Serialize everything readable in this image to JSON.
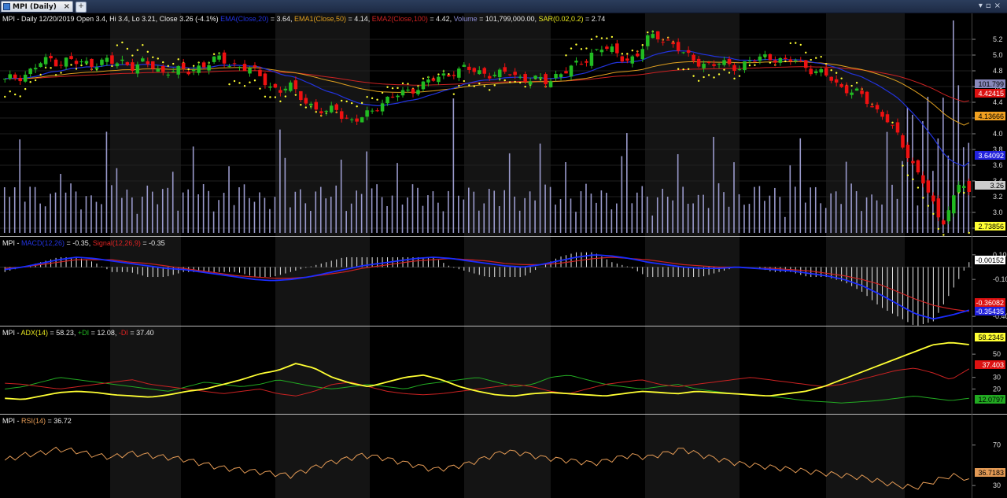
{
  "tab": {
    "title": "MPI (Daily)"
  },
  "header": {
    "sym": "MPI",
    "daily": " - Daily 12/20/2019 Open 3.4, Hi 3.4, Lo 3.21, Close 3.26 (-4.1%) ",
    "ema": "EMA(Close,20)",
    "ema_v": " = 3.64, ",
    "ema1": "EMA1(Close,50)",
    "ema1_v": " = 4.14, ",
    "ema2": "EMA2(Close,100)",
    "ema2_v": " = 4.42, ",
    "vol": "Volume",
    "vol_v": " = 101,799,000.00, ",
    "sar": "SAR(0.02,0.2)",
    "sar_v": " = 2.74"
  },
  "macd_header": {
    "sym": "MPI",
    "sep": " - ",
    "macd": "MACD(12,26)",
    "macd_v": " = -0.35, ",
    "signal": "Signal(12,26,9)",
    "signal_v": " = -0.35"
  },
  "adx_header": {
    "sym": "MPI",
    "sep": " - ",
    "adx": "ADX(14)",
    "adx_v": " = 58.23, ",
    "pdi": "+DI",
    "pdi_v": " = 12.08, ",
    "mdi": "-DI",
    "mdi_v": " = 37.40"
  },
  "rsi_header": {
    "sym": "MPI",
    "sep": " - ",
    "rsi": "RSI(14)",
    "rsi_v": " = 36.72"
  },
  "axes": {
    "price_ticks": [
      "5.2",
      "5.0",
      "4.8",
      "4.6",
      "4.4",
      "4.2",
      "4.0",
      "3.8",
      "3.6",
      "3.4",
      "3.2",
      "3.0",
      "2.8"
    ],
    "macd_ticks": [
      "0.10",
      "-0.10",
      "-0.40"
    ],
    "adx_ticks": [
      "50",
      "30",
      "20"
    ],
    "rsi_ticks": [
      "70",
      "30"
    ]
  },
  "value_tags": {
    "vol": "101.799",
    "ema2": "4.42415",
    "ema1": "4.13666",
    "ema": "3.64092",
    "close": "3.26",
    "sar": "2.73856",
    "hist": "-0.00152",
    "signal": "-0.36082",
    "macd": "-0.35435",
    "adx": "58.2345",
    "mdi": "37.403",
    "pdi": "12.0797",
    "rsi": "36.7183"
  },
  "colors": {
    "bg": "#000000",
    "bull": "#22bb22",
    "bear": "#ee1111",
    "ema": "#2233dd",
    "ema1": "#e0a020",
    "ema2": "#cc2222",
    "volume": "#9a9acc",
    "sar": "#ffff33",
    "macd": "#1a2cff",
    "signal": "#cc2222",
    "adx": "#ffff33",
    "pdi": "#22aa22",
    "mdi": "#cc2222",
    "rsi": "#e39a55"
  },
  "chart_data": {
    "type": "candlestick",
    "symbol": "MPI",
    "period": "Daily",
    "last_bar": {
      "date": "12/20/2019",
      "open": 3.4,
      "high": 3.4,
      "low": 3.21,
      "close": 3.26,
      "change_pct": -4.1
    },
    "price_ylim": [
      2.74,
      5.4
    ],
    "close_series": [
      4.67,
      4.72,
      4.74,
      4.82,
      4.9,
      4.95,
      4.9,
      4.95,
      4.88,
      4.9,
      4.9,
      4.93,
      4.88,
      4.92,
      4.86,
      4.9,
      4.85,
      4.78,
      4.82,
      4.8,
      4.78,
      4.85,
      4.9,
      4.95,
      4.9,
      4.88,
      4.85,
      4.8,
      4.7,
      4.6,
      4.55,
      4.6,
      4.5,
      4.4,
      4.3,
      4.25,
      4.35,
      4.2,
      4.15,
      4.2,
      4.3,
      4.4,
      4.45,
      4.5,
      4.55,
      4.6,
      4.65,
      4.7,
      4.75,
      4.8,
      4.82,
      4.8,
      4.78,
      4.76,
      4.75,
      4.78,
      4.72,
      4.7,
      4.68,
      4.65,
      4.75,
      4.8,
      4.85,
      4.9,
      5.05,
      5.1,
      5.05,
      4.98,
      4.95,
      5.0,
      5.2,
      5.25,
      5.2,
      5.1,
      5.0,
      4.95,
      4.9,
      4.85,
      4.9,
      4.88,
      4.85,
      4.9,
      4.95,
      5.0,
      4.95,
      4.9,
      4.95,
      4.88,
      4.8,
      4.75,
      4.7,
      4.6,
      4.55,
      4.5,
      4.4,
      4.3,
      4.2,
      4.0,
      3.8,
      3.6,
      3.4,
      3.1,
      2.85,
      3.1,
      3.4,
      3.26
    ],
    "ema20_last": 3.64,
    "ema50_last": 4.14,
    "ema100_last": 4.42,
    "sar_last": 2.74,
    "volume_last": 101799000,
    "macd": {
      "ylim": [
        -0.45,
        0.15
      ],
      "macd_last": -0.35,
      "signal_last": -0.35,
      "histogram_last": -0.00152,
      "macd_series": [
        -0.02,
        0.0,
        0.03,
        0.06,
        0.08,
        0.07,
        0.05,
        0.03,
        0.01,
        -0.01,
        -0.02,
        -0.04,
        -0.06,
        -0.08,
        -0.1,
        -0.11,
        -0.1,
        -0.08,
        -0.05,
        -0.02,
        0.01,
        0.03,
        0.05,
        0.07,
        0.08,
        0.07,
        0.05,
        0.03,
        0.01,
        0.0,
        0.02,
        0.05,
        0.08,
        0.1,
        0.09,
        0.07,
        0.04,
        0.02,
        0.0,
        -0.01,
        -0.01,
        0.0,
        -0.01,
        -0.02,
        -0.03,
        -0.05,
        -0.07,
        -0.1,
        -0.15,
        -0.22,
        -0.3,
        -0.38,
        -0.42,
        -0.39,
        -0.35
      ],
      "signal_series": [
        -0.01,
        0.0,
        0.02,
        0.04,
        0.06,
        0.06,
        0.06,
        0.04,
        0.03,
        0.01,
        -0.01,
        -0.03,
        -0.05,
        -0.07,
        -0.08,
        -0.09,
        -0.09,
        -0.08,
        -0.06,
        -0.04,
        -0.01,
        0.01,
        0.03,
        0.05,
        0.06,
        0.07,
        0.06,
        0.05,
        0.03,
        0.02,
        0.02,
        0.03,
        0.05,
        0.07,
        0.08,
        0.07,
        0.06,
        0.04,
        0.02,
        0.01,
        0.0,
        0.0,
        -0.01,
        -0.01,
        -0.02,
        -0.03,
        -0.05,
        -0.07,
        -0.1,
        -0.14,
        -0.2,
        -0.26,
        -0.31,
        -0.34,
        -0.36
      ]
    },
    "adx": {
      "ylim": [
        0,
        65
      ],
      "adx_last": 58.23,
      "pdi_last": 12.08,
      "mdi_last": 37.4,
      "adx_series": [
        12,
        11,
        14,
        17,
        18,
        17,
        15,
        14,
        13,
        15,
        18,
        20,
        24,
        28,
        33,
        36,
        42,
        38,
        30,
        25,
        22,
        26,
        30,
        32,
        28,
        22,
        18,
        15,
        14,
        16,
        17,
        16,
        15,
        14,
        16,
        18,
        17,
        16,
        18,
        17,
        16,
        15,
        14,
        16,
        18,
        22,
        28,
        34,
        40,
        46,
        52,
        58,
        60,
        58.23
      ],
      "pdi_series": [
        20,
        22,
        26,
        30,
        28,
        26,
        24,
        22,
        20,
        18,
        22,
        26,
        24,
        22,
        24,
        28,
        25,
        22,
        20,
        22,
        24,
        22,
        20,
        24,
        26,
        28,
        30,
        26,
        22,
        24,
        30,
        32,
        28,
        24,
        22,
        20,
        22,
        24,
        20,
        18,
        16,
        15,
        14,
        12,
        10,
        9,
        8,
        9,
        10,
        12,
        14,
        12,
        10,
        12.08
      ],
      "mdi_series": [
        25,
        24,
        22,
        20,
        22,
        24,
        26,
        28,
        24,
        22,
        20,
        18,
        16,
        18,
        20,
        16,
        14,
        18,
        24,
        26,
        22,
        18,
        16,
        15,
        16,
        18,
        20,
        22,
        24,
        22,
        18,
        16,
        20,
        24,
        26,
        28,
        24,
        22,
        24,
        26,
        28,
        30,
        28,
        26,
        24,
        22,
        24,
        28,
        32,
        36,
        38,
        34,
        28,
        37.4
      ]
    },
    "rsi": {
      "ylim": [
        20,
        90
      ],
      "rsi_last": 36.72,
      "rsi_series": [
        55,
        60,
        62,
        66,
        64,
        60,
        58,
        62,
        60,
        58,
        56,
        52,
        48,
        46,
        44,
        42,
        40,
        46,
        52,
        56,
        60,
        58,
        54,
        50,
        46,
        48,
        52,
        58,
        64,
        62,
        58,
        56,
        54,
        52,
        56,
        60,
        58,
        62,
        66,
        60,
        56,
        52,
        50,
        48,
        46,
        44,
        42,
        40,
        38,
        34,
        30,
        28,
        34,
        40,
        36.72
      ]
    }
  }
}
